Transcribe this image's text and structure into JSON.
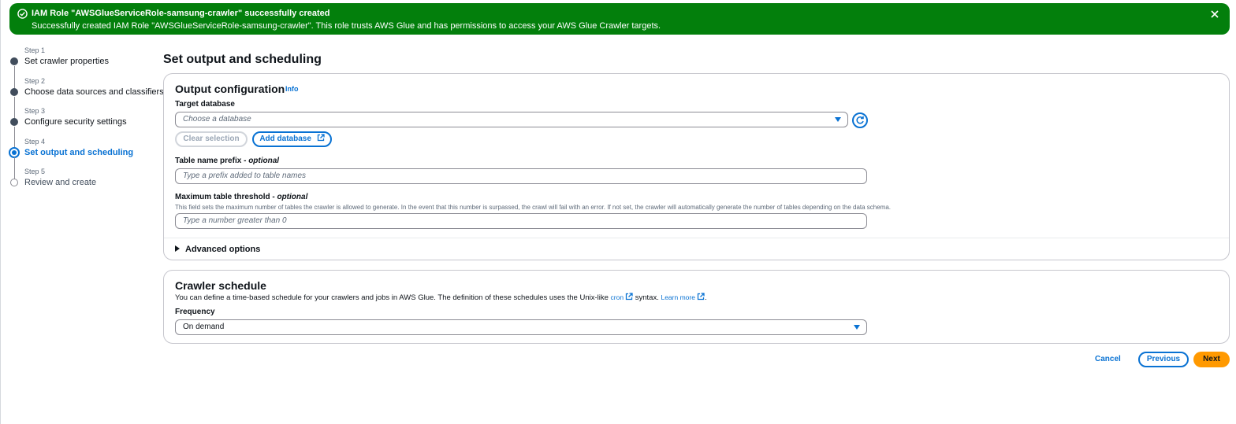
{
  "flash": {
    "title": "IAM Role \"AWSGlueServiceRole-samsung-crawler\" successfully created",
    "message": "Successfully created IAM Role \"AWSGlueServiceRole-samsung-crawler\". This role trusts AWS Glue and has permissions to access your AWS Glue Crawler targets.",
    "icon": "success-check-icon",
    "close_icon": "close-icon",
    "color": "#037f0c"
  },
  "steps": [
    {
      "num": "Step 1",
      "label": "Set crawler properties",
      "state": "completed"
    },
    {
      "num": "Step 2",
      "label": "Choose data sources and classifiers",
      "state": "completed"
    },
    {
      "num": "Step 3",
      "label": "Configure security settings",
      "state": "completed"
    },
    {
      "num": "Step 4",
      "label": "Set output and scheduling",
      "state": "current"
    },
    {
      "num": "Step 5",
      "label": "Review and create",
      "state": "upcoming"
    }
  ],
  "page_title": "Set output and scheduling",
  "output": {
    "title": "Output configuration",
    "info": "Info",
    "target_db_label": "Target database",
    "target_db_placeholder": "Choose a database",
    "clear_selection": "Clear selection",
    "add_database": "Add database",
    "prefix_label": "Table name prefix - ",
    "prefix_optional": "optional",
    "prefix_placeholder": "Type a prefix added to table names",
    "threshold_label": "Maximum table threshold - ",
    "threshold_optional": "optional",
    "threshold_desc": "This field sets the maximum number of tables the crawler is allowed to generate. In the event that this number is surpassed, the crawl will fail with an error. If not set, the crawler will automatically generate the number of tables depending on the data schema.",
    "threshold_placeholder": "Type a number greater than 0",
    "advanced": "Advanced options"
  },
  "schedule": {
    "title": "Crawler schedule",
    "desc_before": "You can define a time-based schedule for your crawlers and jobs in AWS Glue. The definition of these schedules uses the Unix-like ",
    "cron_link": "cron",
    "desc_middle": " syntax. ",
    "learn_more": "Learn more",
    "desc_end": ".",
    "frequency_label": "Frequency",
    "frequency_value": "On demand"
  },
  "footer": {
    "cancel": "Cancel",
    "previous": "Previous",
    "next": "Next"
  },
  "colors": {
    "accent": "#0972d3",
    "primary_button": "#ff9900"
  }
}
